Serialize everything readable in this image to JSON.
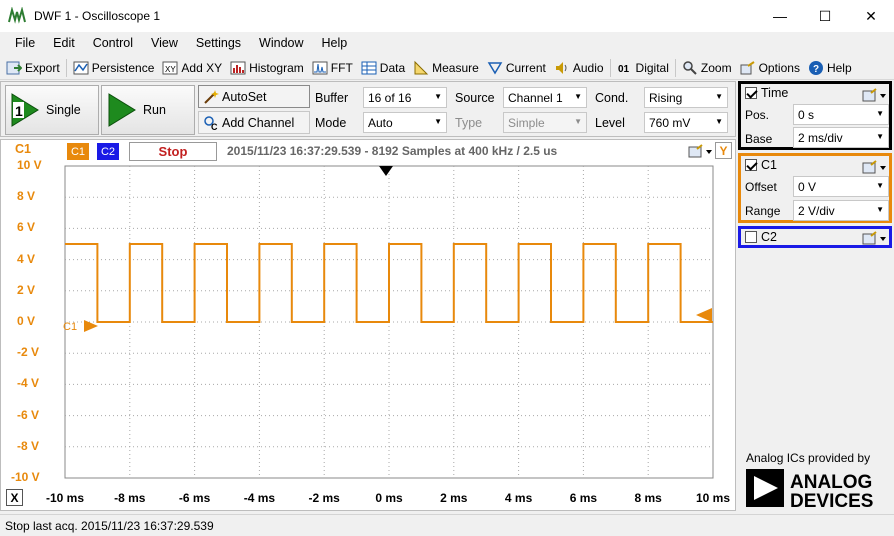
{
  "window": {
    "title": "DWF 1 - Oscilloscope 1",
    "controls": {
      "minimize": "—",
      "maximize": "☐",
      "close": "✕"
    }
  },
  "menu": [
    "File",
    "Edit",
    "Control",
    "View",
    "Settings",
    "Window",
    "Help"
  ],
  "toolbar": {
    "items": [
      {
        "label": "Export",
        "icon": "export-icon"
      },
      {
        "label": "Persistence",
        "icon": "persistence-icon"
      },
      {
        "label": "Add XY",
        "icon": "xy-icon"
      },
      {
        "label": "Histogram",
        "icon": "histogram-icon"
      },
      {
        "label": "FFT",
        "icon": "fft-icon"
      },
      {
        "label": "Data",
        "icon": "data-table-icon"
      },
      {
        "label": "Measure",
        "icon": "measure-icon"
      },
      {
        "label": "Current",
        "icon": "current-icon"
      },
      {
        "label": "Audio",
        "icon": "audio-icon"
      },
      {
        "label": "Digital",
        "icon": "digital-icon"
      },
      {
        "label": "Zoom",
        "icon": "zoom-icon"
      },
      {
        "label": "Options",
        "icon": "options-icon"
      },
      {
        "label": "Help",
        "icon": "help-icon"
      }
    ]
  },
  "controls": {
    "single": "Single",
    "run": "Run",
    "autoset": "AutoSet",
    "add_channel": "Add Channel",
    "buffer_label": "Buffer",
    "buffer_value": "16 of 16",
    "mode_label": "Mode",
    "mode_value": "Auto",
    "source_label": "Source",
    "source_value": "Channel 1",
    "type_label": "Type",
    "type_value": "Simple",
    "cond_label": "Cond.",
    "cond_value": "Rising",
    "level_label": "Level",
    "level_value": "760 mV"
  },
  "scope": {
    "channel_label": "C1",
    "chips": [
      "C1",
      "C2"
    ],
    "state": "Stop",
    "info": "2015/11/23  16:37:29.539 - 8192 Samples at 400 kHz / 2.5 us",
    "y_button": "Y",
    "x_button": "X",
    "trace_marker": "C1",
    "y_ticks": [
      "10 V",
      "8 V",
      "6 V",
      "4 V",
      "2 V",
      "0 V",
      "-2 V",
      "-4 V",
      "-6 V",
      "-8 V",
      "-10 V"
    ],
    "x_ticks": [
      "-10 ms",
      "-8 ms",
      "-6 ms",
      "-4 ms",
      "-2 ms",
      "0 ms",
      "2 ms",
      "4 ms",
      "6 ms",
      "8 ms",
      "10 ms"
    ],
    "colors": {
      "c1": "#e8890c",
      "c2": "#1a1ae6",
      "grid": "#a8a8a8",
      "stop": "#c21f1f"
    }
  },
  "chart_data": {
    "type": "line",
    "x_unit": "ms",
    "y_unit": "V",
    "xlim": [
      -10,
      10
    ],
    "ylim": [
      -10,
      10
    ],
    "grid": true,
    "series": [
      {
        "name": "C1",
        "color": "#e8890c",
        "points": [
          [
            -10,
            5
          ],
          [
            -9,
            5
          ],
          [
            -9,
            0
          ],
          [
            -8,
            0
          ],
          [
            -8,
            5
          ],
          [
            -7,
            5
          ],
          [
            -7,
            0
          ],
          [
            -6,
            0
          ],
          [
            -6,
            5
          ],
          [
            -5,
            5
          ],
          [
            -5,
            0
          ],
          [
            -4,
            0
          ],
          [
            -4,
            5
          ],
          [
            -3,
            5
          ],
          [
            -3,
            0
          ],
          [
            -2,
            0
          ],
          [
            -2,
            5
          ],
          [
            -1,
            5
          ],
          [
            -1,
            0
          ],
          [
            0,
            0
          ],
          [
            0,
            5
          ],
          [
            1,
            5
          ],
          [
            1,
            0
          ],
          [
            2,
            0
          ],
          [
            2,
            5
          ],
          [
            3,
            5
          ],
          [
            3,
            0
          ],
          [
            4,
            0
          ],
          [
            4,
            5
          ],
          [
            5,
            5
          ],
          [
            5,
            0
          ],
          [
            6,
            0
          ],
          [
            6,
            5
          ],
          [
            7,
            5
          ],
          [
            7,
            0
          ],
          [
            8,
            0
          ],
          [
            8,
            5
          ],
          [
            9,
            5
          ],
          [
            9,
            0
          ],
          [
            10,
            0
          ]
        ]
      }
    ]
  },
  "time_panel": {
    "title": "Time",
    "pos_label": "Pos.",
    "pos_value": "0 s",
    "base_label": "Base",
    "base_value": "2 ms/div"
  },
  "c1_panel": {
    "title": "C1",
    "offset_label": "Offset",
    "offset_value": "0 V",
    "range_label": "Range",
    "range_value": "2 V/div"
  },
  "c2_panel": {
    "title": "C2"
  },
  "branding": {
    "text": "Analog ICs provided by",
    "logo_line1": "ANALOG",
    "logo_line2": "DEVICES"
  },
  "status": "Stop last acq. 2015/11/23  16:37:29.539"
}
